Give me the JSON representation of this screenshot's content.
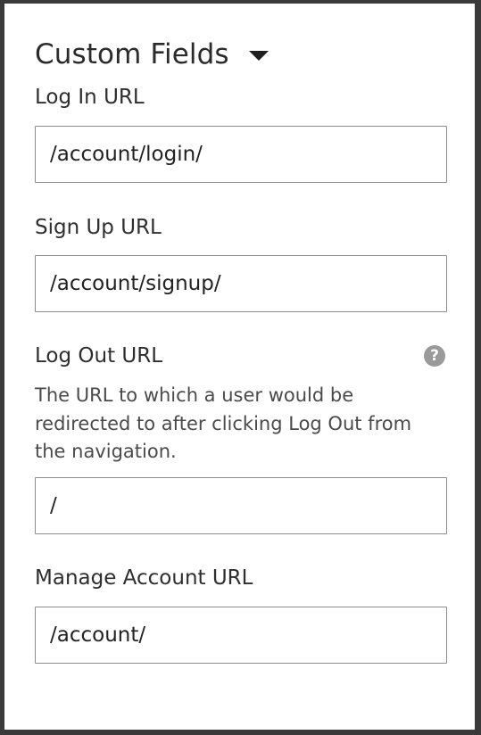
{
  "section": {
    "title": "Custom Fields",
    "caret_icon": "caret-down-icon"
  },
  "fields": {
    "login": {
      "label": "Log In URL",
      "value": "/account/login/"
    },
    "signup": {
      "label": "Sign Up URL",
      "value": "/account/signup/"
    },
    "logout": {
      "label": "Log Out URL",
      "help_icon": "question-mark-icon",
      "help_glyph": "?",
      "help_text": "The URL to which a user would be redirected to after clicking Log Out from the navigation.",
      "value": "/"
    },
    "manage": {
      "label": "Manage Account URL",
      "value": "/account/"
    }
  },
  "colors": {
    "text": "#2e2e2e",
    "input_border": "#8c8c8c",
    "help_icon_bg": "#9a9a9a",
    "frame": "#3a3a3a"
  }
}
